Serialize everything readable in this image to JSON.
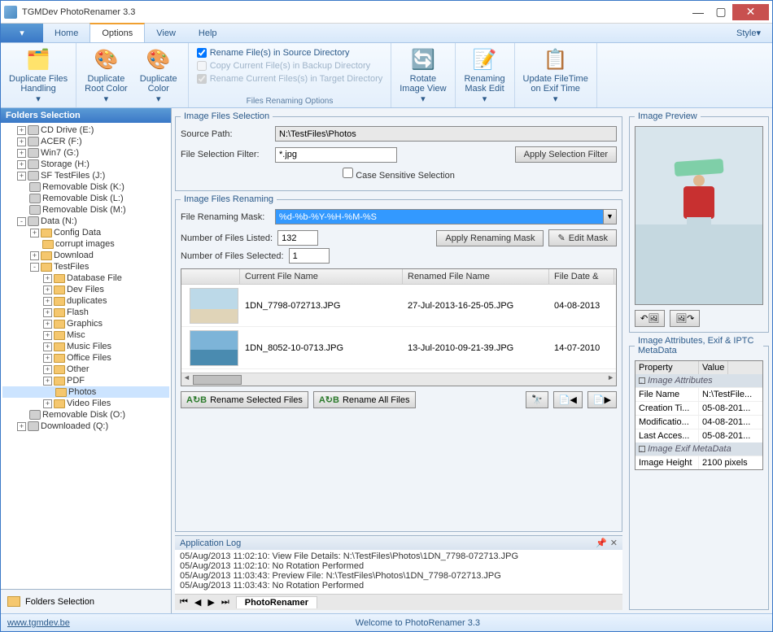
{
  "title": "TGMDev PhotoRenamer 3.3",
  "menus": {
    "home": "Home",
    "options": "Options",
    "view": "View",
    "help": "Help",
    "style": "Style"
  },
  "ribbon": {
    "dup_files": "Duplicate Files\nHandling",
    "dup_root": "Duplicate\nRoot Color",
    "dup_color": "Duplicate\nColor",
    "chk_rename_src": "Rename File(s) in Source Directory",
    "chk_copy_backup": "Copy Current File(s) in Backup Directory",
    "chk_rename_target": "Rename Current Files(s) in Target Directory",
    "group_files": "Files Renaming Options",
    "rotate": "Rotate\nImage View",
    "mask_edit": "Renaming\nMask Edit",
    "update_time": "Update FileTime\non Exif Time"
  },
  "folders_title": "Folders Selection",
  "tree": [
    {
      "lvl": 1,
      "exp": "+",
      "ico": "drive",
      "label": "CD Drive (E:)"
    },
    {
      "lvl": 1,
      "exp": "+",
      "ico": "drive",
      "label": "ACER (F:)"
    },
    {
      "lvl": 1,
      "exp": "+",
      "ico": "drive",
      "label": "Win7 (G:)"
    },
    {
      "lvl": 1,
      "exp": "+",
      "ico": "drive",
      "label": "Storage (H:)"
    },
    {
      "lvl": 1,
      "exp": "+",
      "ico": "drive",
      "label": "SF TestFiles (J:)"
    },
    {
      "lvl": 1,
      "exp": "",
      "ico": "drive",
      "label": "Removable Disk (K:)"
    },
    {
      "lvl": 1,
      "exp": "",
      "ico": "drive",
      "label": "Removable Disk (L:)"
    },
    {
      "lvl": 1,
      "exp": "",
      "ico": "drive",
      "label": "Removable Disk (M:)"
    },
    {
      "lvl": 1,
      "exp": "-",
      "ico": "drive",
      "label": "Data (N:)"
    },
    {
      "lvl": 2,
      "exp": "+",
      "ico": "folder",
      "label": "Config Data"
    },
    {
      "lvl": 2,
      "exp": "",
      "ico": "folder",
      "label": "corrupt images"
    },
    {
      "lvl": 2,
      "exp": "+",
      "ico": "folder",
      "label": "Download"
    },
    {
      "lvl": 2,
      "exp": "-",
      "ico": "folder",
      "label": "TestFiles"
    },
    {
      "lvl": 3,
      "exp": "+",
      "ico": "folder",
      "label": "Database File"
    },
    {
      "lvl": 3,
      "exp": "+",
      "ico": "folder",
      "label": "Dev Files"
    },
    {
      "lvl": 3,
      "exp": "+",
      "ico": "folder",
      "label": "duplicates"
    },
    {
      "lvl": 3,
      "exp": "+",
      "ico": "folder",
      "label": "Flash"
    },
    {
      "lvl": 3,
      "exp": "+",
      "ico": "folder",
      "label": "Graphics"
    },
    {
      "lvl": 3,
      "exp": "+",
      "ico": "folder",
      "label": "Misc"
    },
    {
      "lvl": 3,
      "exp": "+",
      "ico": "folder",
      "label": "Music Files"
    },
    {
      "lvl": 3,
      "exp": "+",
      "ico": "folder",
      "label": "Office Files"
    },
    {
      "lvl": 3,
      "exp": "+",
      "ico": "folder",
      "label": "Other"
    },
    {
      "lvl": 3,
      "exp": "+",
      "ico": "folder",
      "label": "PDF"
    },
    {
      "lvl": 3,
      "exp": "",
      "ico": "folder",
      "label": "Photos",
      "sel": true
    },
    {
      "lvl": 3,
      "exp": "+",
      "ico": "folder",
      "label": "Video Files"
    },
    {
      "lvl": 1,
      "exp": "",
      "ico": "drive",
      "label": "Removable Disk (O:)"
    },
    {
      "lvl": 1,
      "exp": "+",
      "ico": "drive",
      "label": "Downloaded (Q:)"
    }
  ],
  "selection": {
    "legend": "Image Files Selection",
    "source_path_label": "Source Path:",
    "source_path": "N:\\TestFiles\\Photos",
    "filter_label": "File Selection Filter:",
    "filter": "*.jpg",
    "apply_filter_btn": "Apply Selection Filter",
    "case_sensitive": "Case Sensitive Selection"
  },
  "renaming": {
    "legend": "Image Files Renaming",
    "mask_label": "File Renaming Mask:",
    "mask": "%d-%b-%Y-%H-%M-%S",
    "listed_label": "Number of Files Listed:",
    "listed": "132",
    "selected_label": "Number of Files Selected:",
    "selected": "1",
    "apply_mask_btn": "Apply Renaming Mask",
    "edit_mask_btn": "Edit Mask",
    "col_current": "Current File Name",
    "col_renamed": "Renamed File Name",
    "col_date": "File Date &",
    "rows": [
      {
        "cur": "1DN_7798-072713.JPG",
        "ren": "27-Jul-2013-16-25-05.JPG",
        "date": "04-08-2013"
      },
      {
        "cur": "1DN_8052-10-0713.JPG",
        "ren": "13-Jul-2010-09-21-39.JPG",
        "date": "14-07-2010"
      }
    ],
    "rename_selected": "Rename Selected Files",
    "rename_all": "Rename All Files"
  },
  "preview": {
    "legend": "Image Preview"
  },
  "attrs": {
    "legend": "Image Attributes, Exif & IPTC MetaData",
    "col_prop": "Property",
    "col_val": "Value",
    "cat1": "Image Attributes",
    "rows1": [
      {
        "k": "File Name",
        "v": "N:\\TestFile..."
      },
      {
        "k": "Creation Ti...",
        "v": "05-08-201..."
      },
      {
        "k": "Modificatio...",
        "v": "04-08-201..."
      },
      {
        "k": "Last Acces...",
        "v": "05-08-201..."
      }
    ],
    "cat2": "Image Exif MetaData",
    "rows2": [
      {
        "k": "Image Height",
        "v": "2100 pixels"
      }
    ]
  },
  "log": {
    "title": "Application Log",
    "lines": [
      "05/Aug/2013 11:02:10: View File Details: N:\\TestFiles\\Photos\\1DN_7798-072713.JPG",
      "05/Aug/2013 11:02:10: No Rotation Performed",
      "05/Aug/2013 11:03:43: Preview File: N:\\TestFiles\\Photos\\1DN_7798-072713.JPG",
      "05/Aug/2013 11:03:43: No Rotation Performed"
    ],
    "tab": "PhotoRenamer"
  },
  "status": {
    "link": "www.tgmdev.be",
    "welcome": "Welcome to PhotoRenamer 3.3"
  }
}
